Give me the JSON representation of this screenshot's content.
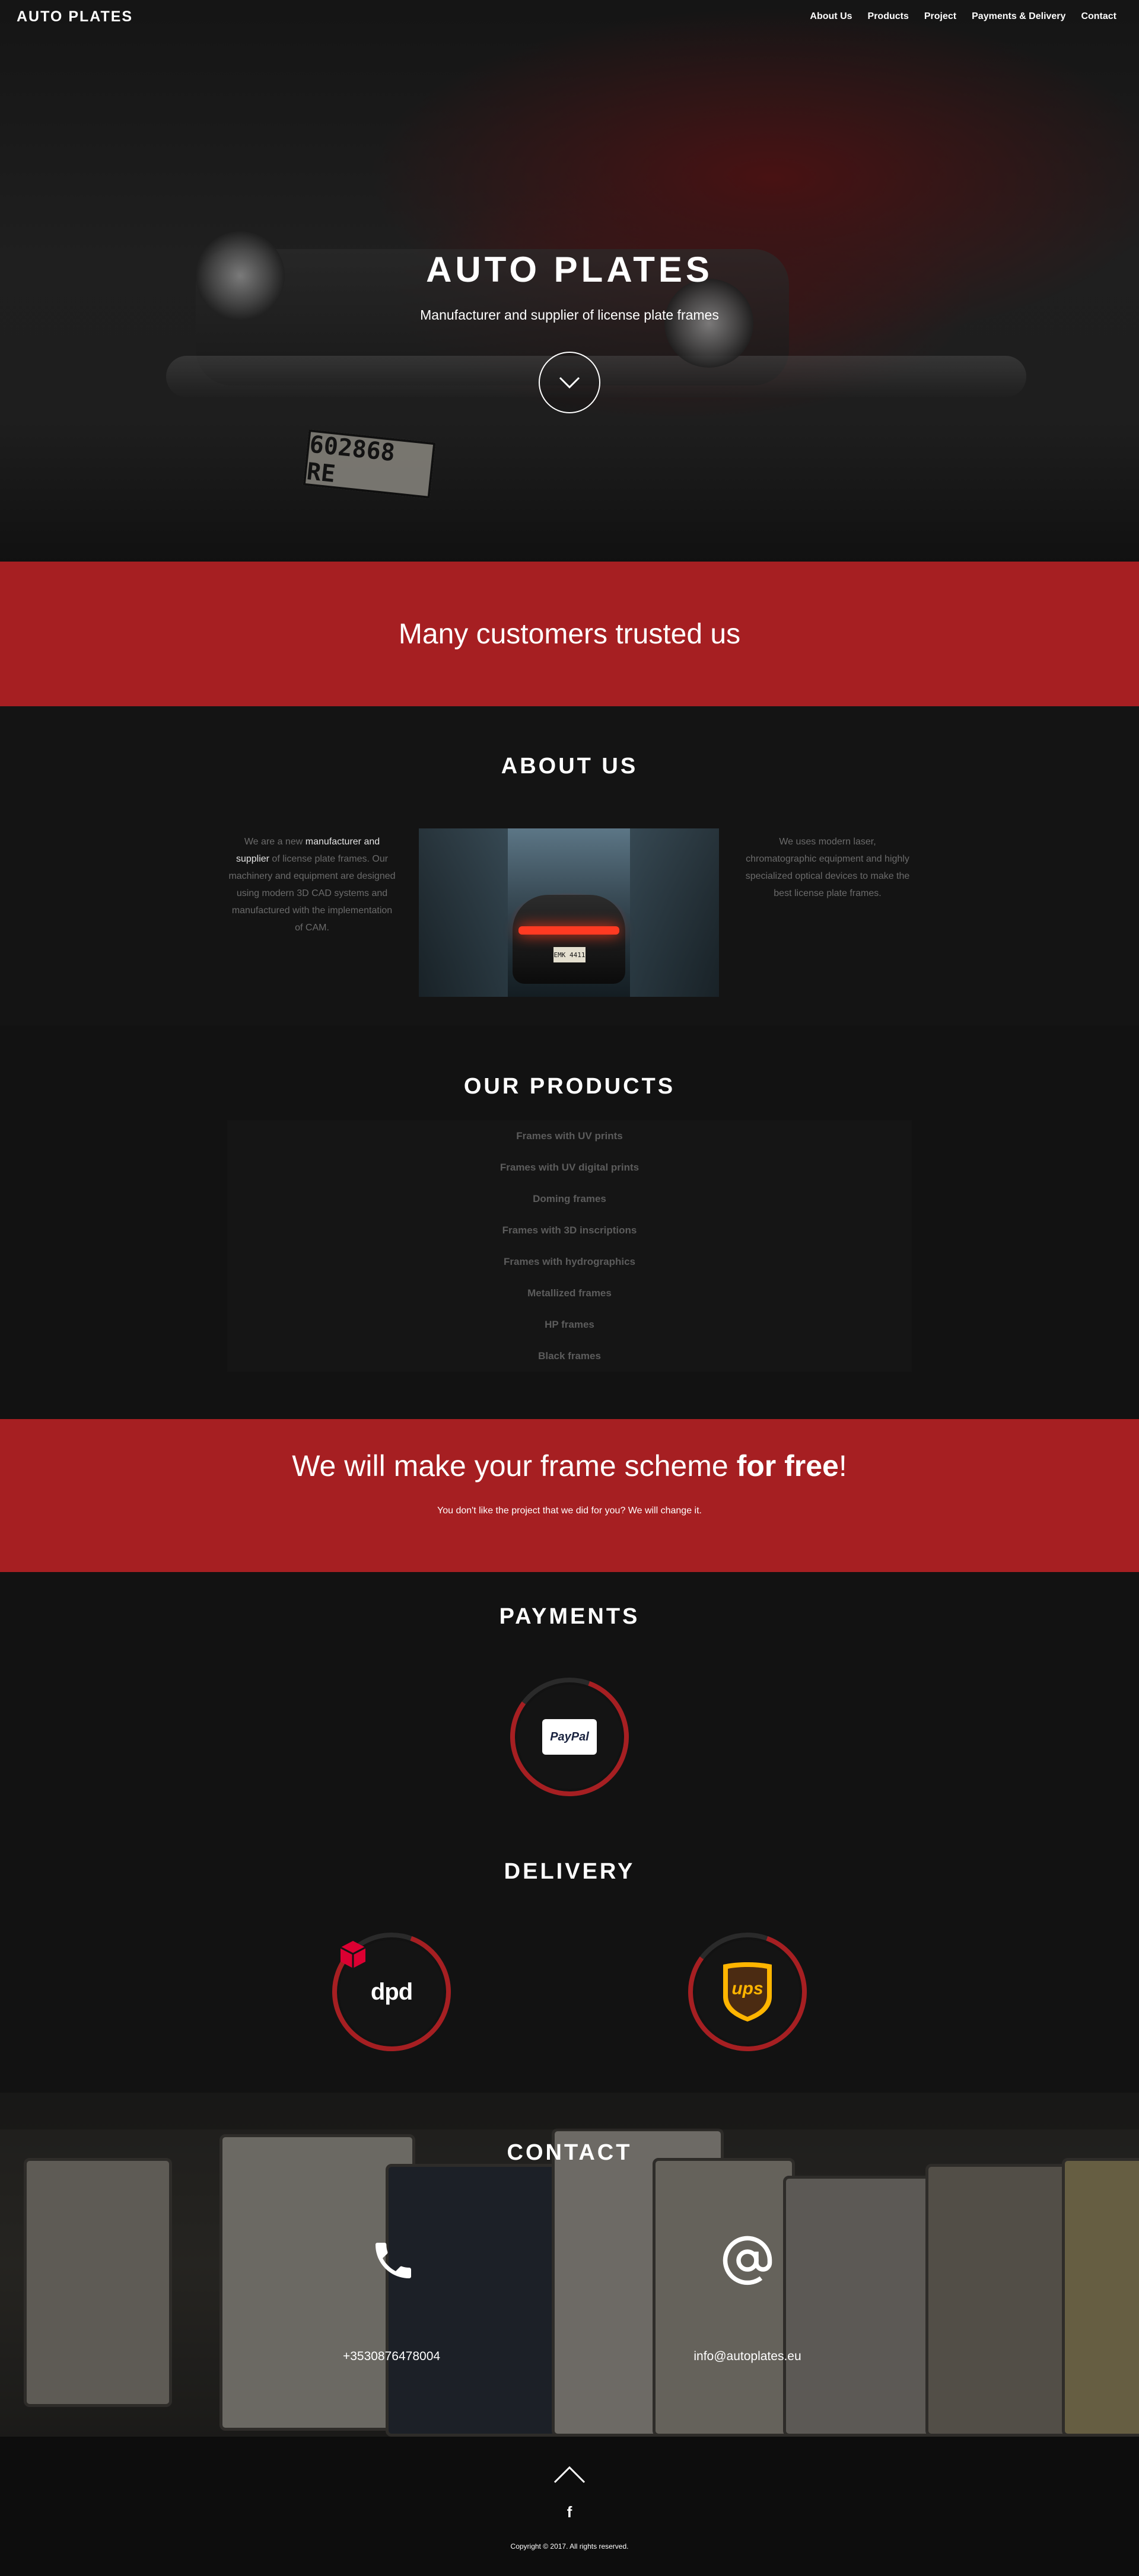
{
  "nav": {
    "logo": "AUTO PLATES",
    "items": [
      {
        "label": "About Us"
      },
      {
        "label": "Products"
      },
      {
        "label": "Project"
      },
      {
        "label": "Payments & Delivery"
      },
      {
        "label": "Contact"
      }
    ]
  },
  "hero": {
    "title": "AUTO PLATES",
    "subtitle": "Manufacturer and supplier of license plate frames",
    "plate_text": "602868 RE",
    "scroll_icon": "chevron-down-icon"
  },
  "trusted": {
    "heading": "Many customers trusted us"
  },
  "about": {
    "title": "ABOUT US",
    "left_pre": "We are a new ",
    "left_bold": "manufacturer and supplier",
    "left_post": " of license plate frames. Our machinery and equipment are designed using modern 3D CAD systems and manufactured with the implementation of CAM.",
    "right_text": "We uses modern laser, chromatographic equipment and highly specialized optical devices to make the best license plate frames.",
    "image_plate": "EMK 4411"
  },
  "products": {
    "title": "OUR PRODUCTS",
    "items": [
      "Frames with UV prints",
      "Frames with UV digital prints",
      "Doming frames",
      "Frames with 3D inscriptions",
      "Frames with hydrographics",
      "Metallized frames",
      "HP frames",
      "Black frames"
    ]
  },
  "free": {
    "heading_pre": "We will make your frame scheme ",
    "heading_bold": "for free",
    "heading_post": "!",
    "sub": "You don't like the project that we did for you? We will change it."
  },
  "payments": {
    "title": "PAYMENTS",
    "logo": "PayPal"
  },
  "delivery": {
    "title": "DELIVERY",
    "logos": [
      "dpd",
      "ups"
    ]
  },
  "contact": {
    "title": "CONTACT",
    "phone": "+3530876478004",
    "email": "info@autoplates.eu",
    "phone_icon": "phone-icon",
    "email_icon": "at-sign-icon"
  },
  "footer": {
    "up_icon": "chevron-up-icon",
    "social_icon": "facebook-icon",
    "social_glyph": "f",
    "copyright": "Copyright © 2017. All rights reserved."
  },
  "colors": {
    "accent": "#a61f22",
    "background": "#121212",
    "text": "#ffffff",
    "muted": "#5c5c5c"
  }
}
